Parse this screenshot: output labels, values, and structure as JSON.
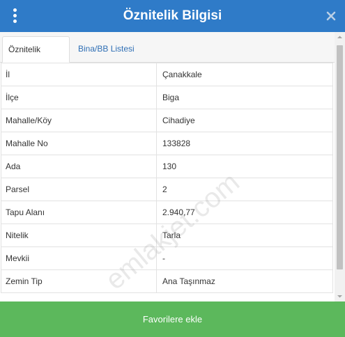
{
  "header": {
    "title": "Öznitelik Bilgisi",
    "menu_icon": "vertical-ellipsis-icon",
    "close_icon": "close-icon"
  },
  "tabs": [
    {
      "label": "Öznitelik Bilgisi",
      "active": true
    },
    {
      "label": "Bina/BB Listesi",
      "active": false
    }
  ],
  "attributes": [
    {
      "key": "İl",
      "value": "Çanakkale"
    },
    {
      "key": "İlçe",
      "value": "Biga"
    },
    {
      "key": "Mahalle/Köy",
      "value": "Cihadiye"
    },
    {
      "key": "Mahalle No",
      "value": "133828"
    },
    {
      "key": "Ada",
      "value": "130"
    },
    {
      "key": "Parsel",
      "value": "2"
    },
    {
      "key": "Tapu Alanı",
      "value": "2.940,77"
    },
    {
      "key": "Nitelik",
      "value": "Tarla"
    },
    {
      "key": "Mevkii",
      "value": "-"
    },
    {
      "key": "Zemin Tip",
      "value": "Ana Taşınmaz"
    }
  ],
  "watermark": "emlakjet.com",
  "footer": {
    "button_label": "Favorilere ekle"
  },
  "colors": {
    "header_bg": "#2f7bc8",
    "footer_bg": "#5cb85c",
    "tab_link": "#2f6fb5"
  }
}
